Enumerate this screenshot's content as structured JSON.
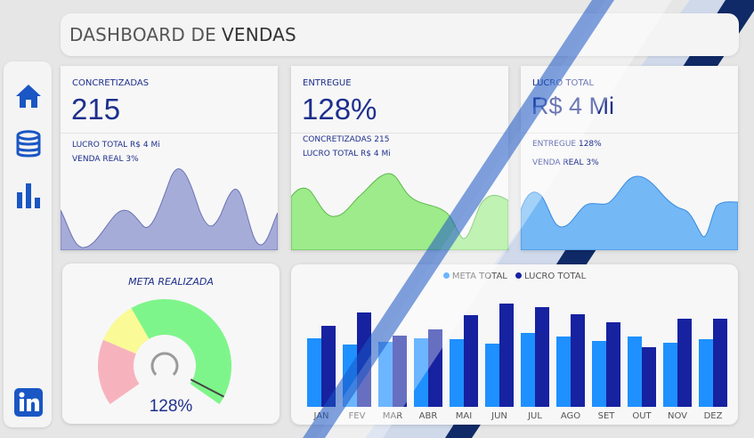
{
  "header": {
    "title_part1": "DASHBOARD DE",
    "title_part2": "VENDAS"
  },
  "sidebar": {
    "items": [
      {
        "icon": "home-icon"
      },
      {
        "icon": "database-icon"
      },
      {
        "icon": "bar-chart-icon"
      }
    ],
    "footer_icon": "linkedin-icon"
  },
  "colors": {
    "primary": "#1e2f8c",
    "sidebar_icon": "#1a56c4",
    "meta_total": "#1e90ff",
    "lucro_total": "#1622a0",
    "spark_1": "#a6acd8",
    "spark_2": "#9deb8a",
    "spark_3": "#74b8f5"
  },
  "kpis": [
    {
      "label": "CONCRETIZADAS",
      "value": "215",
      "sub1": "LUCRO TOTAL R$ 4 Mi",
      "sub2": "VENDA REAL 3%"
    },
    {
      "label": "ENTREGUE",
      "value": "128%",
      "sub1": "CONCRETIZADAS 215",
      "sub2": "LUCRO TOTAL R$ 4 Mi"
    },
    {
      "label": "LUCRO TOTAL",
      "value": "R$ 4 Mi",
      "sub1": "ENTREGUE 128%",
      "sub2": "VENDA REAL 3%"
    }
  ],
  "gauge": {
    "title": "META REALIZADA",
    "value_label": "128%",
    "zones": [
      "#f7b3bd",
      "#fafa96",
      "#7ef58a"
    ],
    "needle_fraction": 0.97
  },
  "chart_data": {
    "type": "bar",
    "categories": [
      "JAN",
      "FEV",
      "MAR",
      "ABR",
      "MAI",
      "JUN",
      "JUL",
      "AGO",
      "SET",
      "OUT",
      "NOV",
      "DEZ"
    ],
    "series": [
      {
        "name": "META TOTAL",
        "values": [
          77,
          70,
          73,
          77,
          76,
          71,
          83,
          79,
          74,
          79,
          72,
          76
        ]
      },
      {
        "name": "LUCRO TOTAL",
        "values": [
          91,
          106,
          80,
          87,
          103,
          116,
          112,
          104,
          95,
          67,
          99,
          99
        ]
      }
    ],
    "ylim": [
      0,
      120
    ],
    "legend": "top-center"
  }
}
